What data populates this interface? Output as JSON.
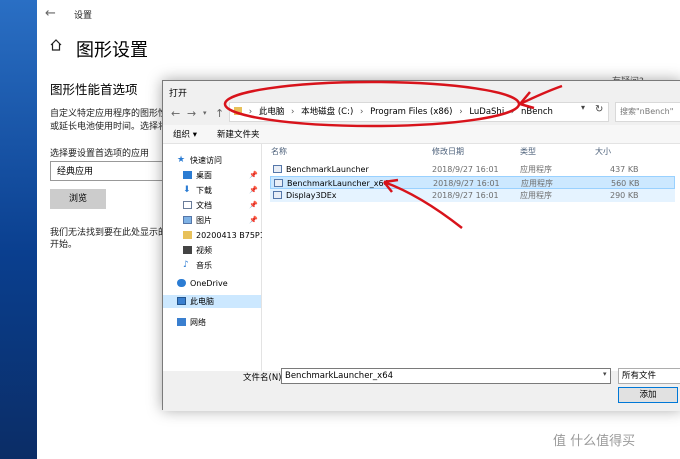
{
  "settings": {
    "window_title": "设置",
    "page_title": "图形设置",
    "section_heading": "图形性能首选项",
    "description_lines": [
      "自定义特定应用程序的图形性能",
      "或延长电池使用时间。选择将在"
    ],
    "choose_app_label": "选择要设置首选项的应用",
    "app_type_value": "经典应用",
    "browse_button": "浏览",
    "notice_lines": [
      "我们无法找到要在此处显示的",
      "开始。"
    ],
    "top_right_text": "有疑问?"
  },
  "dialog": {
    "title": "打开",
    "address_segments": [
      "此电脑",
      "本地磁盘 (C:)",
      "Program Files (x86)",
      "LuDaShi",
      "nBench"
    ],
    "search_placeholder": "搜索\"nBench\"",
    "organize_label": "组织 ▾",
    "new_folder_label": "新建文件夹",
    "nav_items": [
      {
        "label": "快速访问",
        "icon": "star-icon"
      },
      {
        "label": "桌面",
        "icon": "desktop-icon",
        "pinned": true
      },
      {
        "label": "下载",
        "icon": "download-icon",
        "pinned": true
      },
      {
        "label": "文档",
        "icon": "document-icon",
        "pinned": true
      },
      {
        "label": "图片",
        "icon": "picture-icon",
        "pinned": true
      },
      {
        "label": "20200413 B75P10",
        "icon": "folder-icon"
      },
      {
        "label": "视频",
        "icon": "video-icon"
      },
      {
        "label": "音乐",
        "icon": "music-icon"
      },
      {
        "label": "OneDrive",
        "icon": "cloud-icon"
      },
      {
        "label": "此电脑",
        "icon": "computer-icon",
        "selected": true
      },
      {
        "label": "网络",
        "icon": "network-icon"
      }
    ],
    "columns": [
      "名称",
      "修改日期",
      "类型",
      "大小"
    ],
    "files": [
      {
        "name": "BenchmarkLauncher",
        "date": "2018/9/27 16:01",
        "type": "应用程序",
        "size": "437 KB"
      },
      {
        "name": "BenchmarkLauncher_x64",
        "date": "2018/9/27 16:01",
        "type": "应用程序",
        "size": "560 KB",
        "selected": true
      },
      {
        "name": "Display3DEx",
        "date": "2018/9/27 16:01",
        "type": "应用程序",
        "size": "290 KB"
      }
    ],
    "filename_label": "文件名(N):",
    "filename_value": "BenchmarkLauncher_x64",
    "file_type_filter": "所有文件",
    "add_button": "添加"
  },
  "watermark": "值 什么值得买",
  "colors": {
    "annotation": "#d8131b",
    "selection": "#cce8ff",
    "accent": "#0078d7"
  }
}
